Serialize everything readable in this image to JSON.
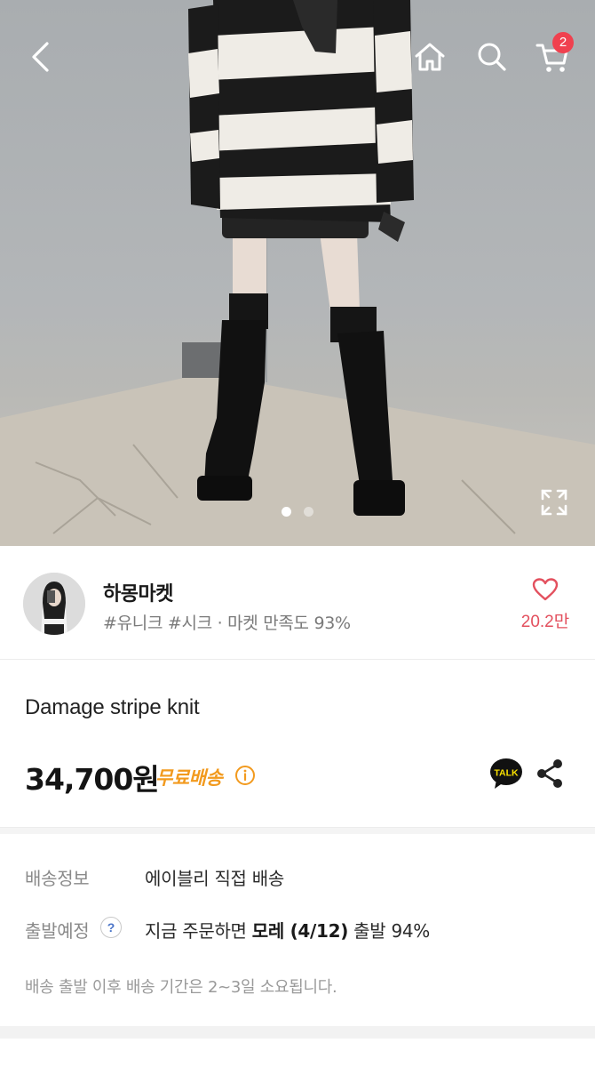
{
  "header": {
    "cart_count": "2",
    "icons": [
      "back-arrow-icon",
      "home-icon",
      "search-icon",
      "cart-icon"
    ]
  },
  "gallery": {
    "current_index": 1,
    "total": 2,
    "expand_icon": "expand-icon"
  },
  "seller": {
    "name": "하몽마켓",
    "tags": "#유니크 #시크 · 마켓 만족도 93%",
    "favorite_count": "20.2만",
    "favorite_icon": "heart-icon"
  },
  "product": {
    "name": "Damage stripe knit",
    "price": "34,700원",
    "shipping_badge": "무료배송",
    "talk_label": "TALK"
  },
  "shipping": {
    "info_label": "배송정보",
    "info_value": "에이블리 직접 배송",
    "departure_label": "출발예정",
    "departure_prefix": "지금 주문하면 ",
    "departure_bold": "모레 (4/12)",
    "departure_suffix": " 출발 94%",
    "note": "배송 출발 이후 배송 기간은 2~3일 소요됩니다."
  },
  "colors": {
    "accent_red": "#f0414f",
    "heart": "#e3505e",
    "free_shipping": "#f29a1e"
  }
}
